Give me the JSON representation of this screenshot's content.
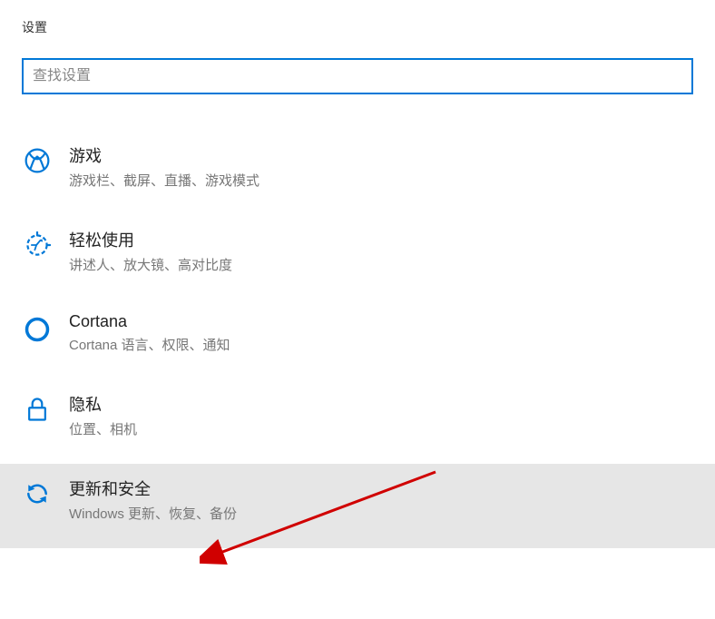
{
  "header": {
    "title": "设置"
  },
  "search": {
    "placeholder": "查找设置",
    "value": ""
  },
  "colors": {
    "accent": "#0078d7",
    "highlight": "#e6e6e6"
  },
  "items": [
    {
      "icon": "xbox-icon",
      "title": "游戏",
      "desc": "游戏栏、截屏、直播、游戏模式",
      "highlighted": false
    },
    {
      "icon": "ease-of-access-icon",
      "title": "轻松使用",
      "desc": "讲述人、放大镜、高对比度",
      "highlighted": false
    },
    {
      "icon": "cortana-icon",
      "title": "Cortana",
      "desc": "Cortana 语言、权限、通知",
      "highlighted": false
    },
    {
      "icon": "privacy-icon",
      "title": "隐私",
      "desc": "位置、相机",
      "highlighted": false
    },
    {
      "icon": "update-icon",
      "title": "更新和安全",
      "desc": "Windows 更新、恢复、备份",
      "highlighted": true
    }
  ]
}
